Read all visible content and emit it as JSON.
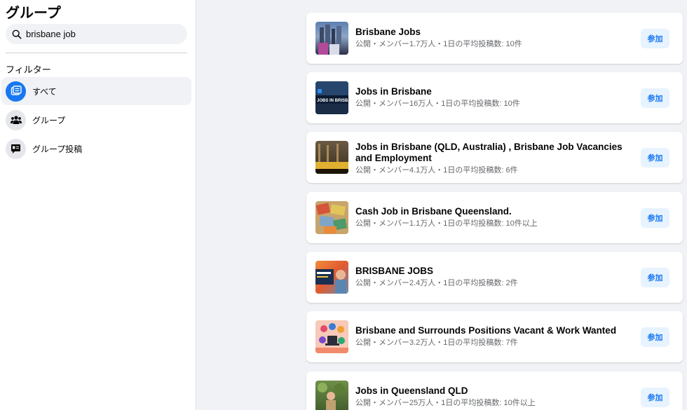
{
  "sidebar": {
    "title": "グループ",
    "search_value": "brisbane job",
    "filters_label": "フィルター",
    "filters": [
      {
        "label": "すべて",
        "icon": "feed-icon",
        "active": true
      },
      {
        "label": "グループ",
        "icon": "people-icon",
        "active": false
      },
      {
        "label": "グループ投稿",
        "icon": "post-icon",
        "active": false
      }
    ]
  },
  "results": [
    {
      "title": "Brisbane Jobs",
      "meta": "公開・メンバー1.7万人・1日の平均投稿数: 10件",
      "join_label": "参加"
    },
    {
      "title": "Jobs in Brisbane",
      "meta": "公開・メンバー16万人・1日の平均投稿数: 10件",
      "join_label": "参加"
    },
    {
      "title": "Jobs in Brisbane (QLD, Australia) , Brisbane Job Vacancies and Employment",
      "meta": "公開・メンバー4.1万人・1日の平均投稿数: 6件",
      "join_label": "参加"
    },
    {
      "title": "Cash Job in Brisbane Queensland.",
      "meta": "公開・メンバー1.1万人・1日の平均投稿数: 10件以上",
      "join_label": "参加"
    },
    {
      "title": "BRISBANE JOBS",
      "meta": "公開・メンバー2.4万人・1日の平均投稿数: 2件",
      "join_label": "参加"
    },
    {
      "title": "Brisbane and Surrounds Positions Vacant & Work Wanted",
      "meta": "公開・メンバー3.2万人・1日の平均投稿数: 7件",
      "join_label": "参加"
    },
    {
      "title": "Jobs in Queensland QLD",
      "meta": "公開・メンバー25万人・1日の平均投稿数: 10件以上",
      "join_label": "参加"
    }
  ],
  "colors": {
    "accent": "#1877f2",
    "button_bg": "#e7f3ff",
    "page_bg": "#f0f2f5"
  }
}
